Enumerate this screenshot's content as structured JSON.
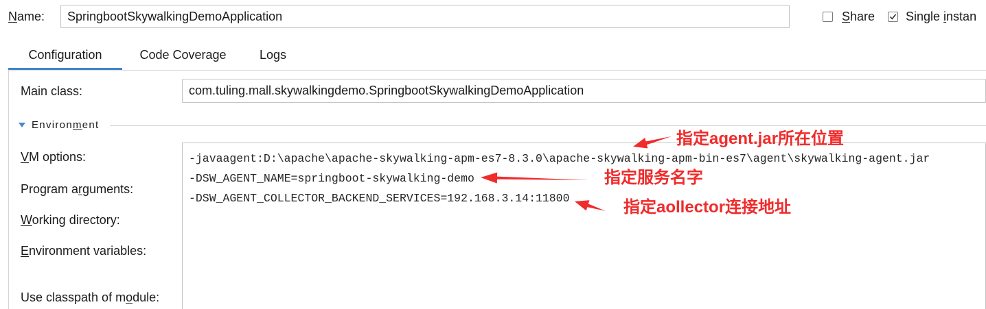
{
  "dialog": {
    "name_label": {
      "text": "Name:",
      "mnemonic_index": 0
    },
    "name_value": "SpringbootSkywalkingDemoApplication",
    "share": {
      "label": {
        "text": "Share",
        "mnemonic_index": 0
      },
      "checked": false
    },
    "single_instance": {
      "label": {
        "text": "Single instan",
        "mnemonic_index": 7
      },
      "checked": true
    }
  },
  "tabs": [
    {
      "label": "Configuration",
      "active": true
    },
    {
      "label": "Code Coverage",
      "active": false
    },
    {
      "label": "Logs",
      "active": false
    }
  ],
  "configuration": {
    "main_class": {
      "label": "Main class:",
      "value": "com.tuling.mall.skywalkingdemo.SpringbootSkywalkingDemoApplication"
    },
    "environment_section": {
      "title": {
        "text": "Environment",
        "mnemonic_index": 7
      },
      "expanded": true,
      "toggle_icon": "triangle-down-icon"
    },
    "vm_options": {
      "label": {
        "text": "VM options:",
        "mnemonic_index": 0
      },
      "lines": [
        "-javaagent:D:\\apache\\apache-skywalking-apm-es7-8.3.0\\apache-skywalking-apm-bin-es7\\agent\\skywalking-agent.jar",
        "-DSW_AGENT_NAME=springboot-skywalking-demo",
        "-DSW_AGENT_COLLECTOR_BACKEND_SERVICES=192.168.3.14:11800"
      ]
    },
    "program_arguments": {
      "label": {
        "text": "Program arguments:",
        "mnemonic_index": 9
      }
    },
    "working_directory": {
      "label": {
        "text": "Working directory:",
        "mnemonic_index": 0
      }
    },
    "environment_variables": {
      "label": {
        "text": "Environment variables:",
        "mnemonic_index": 0
      }
    },
    "use_classpath": {
      "label": {
        "text": "Use classpath of module:",
        "mnemonic_index": 18
      }
    }
  },
  "annotations": [
    {
      "text": "指定agent.jar所在位置"
    },
    {
      "text": "指定服务名字"
    },
    {
      "text": "指定aollector连接地址"
    }
  ],
  "colors": {
    "tab_accent": "#4083c9",
    "annotation_red": "#f02b2b",
    "toggle_triangle": "#4a88cc",
    "field_border": "#c4c4c4"
  }
}
